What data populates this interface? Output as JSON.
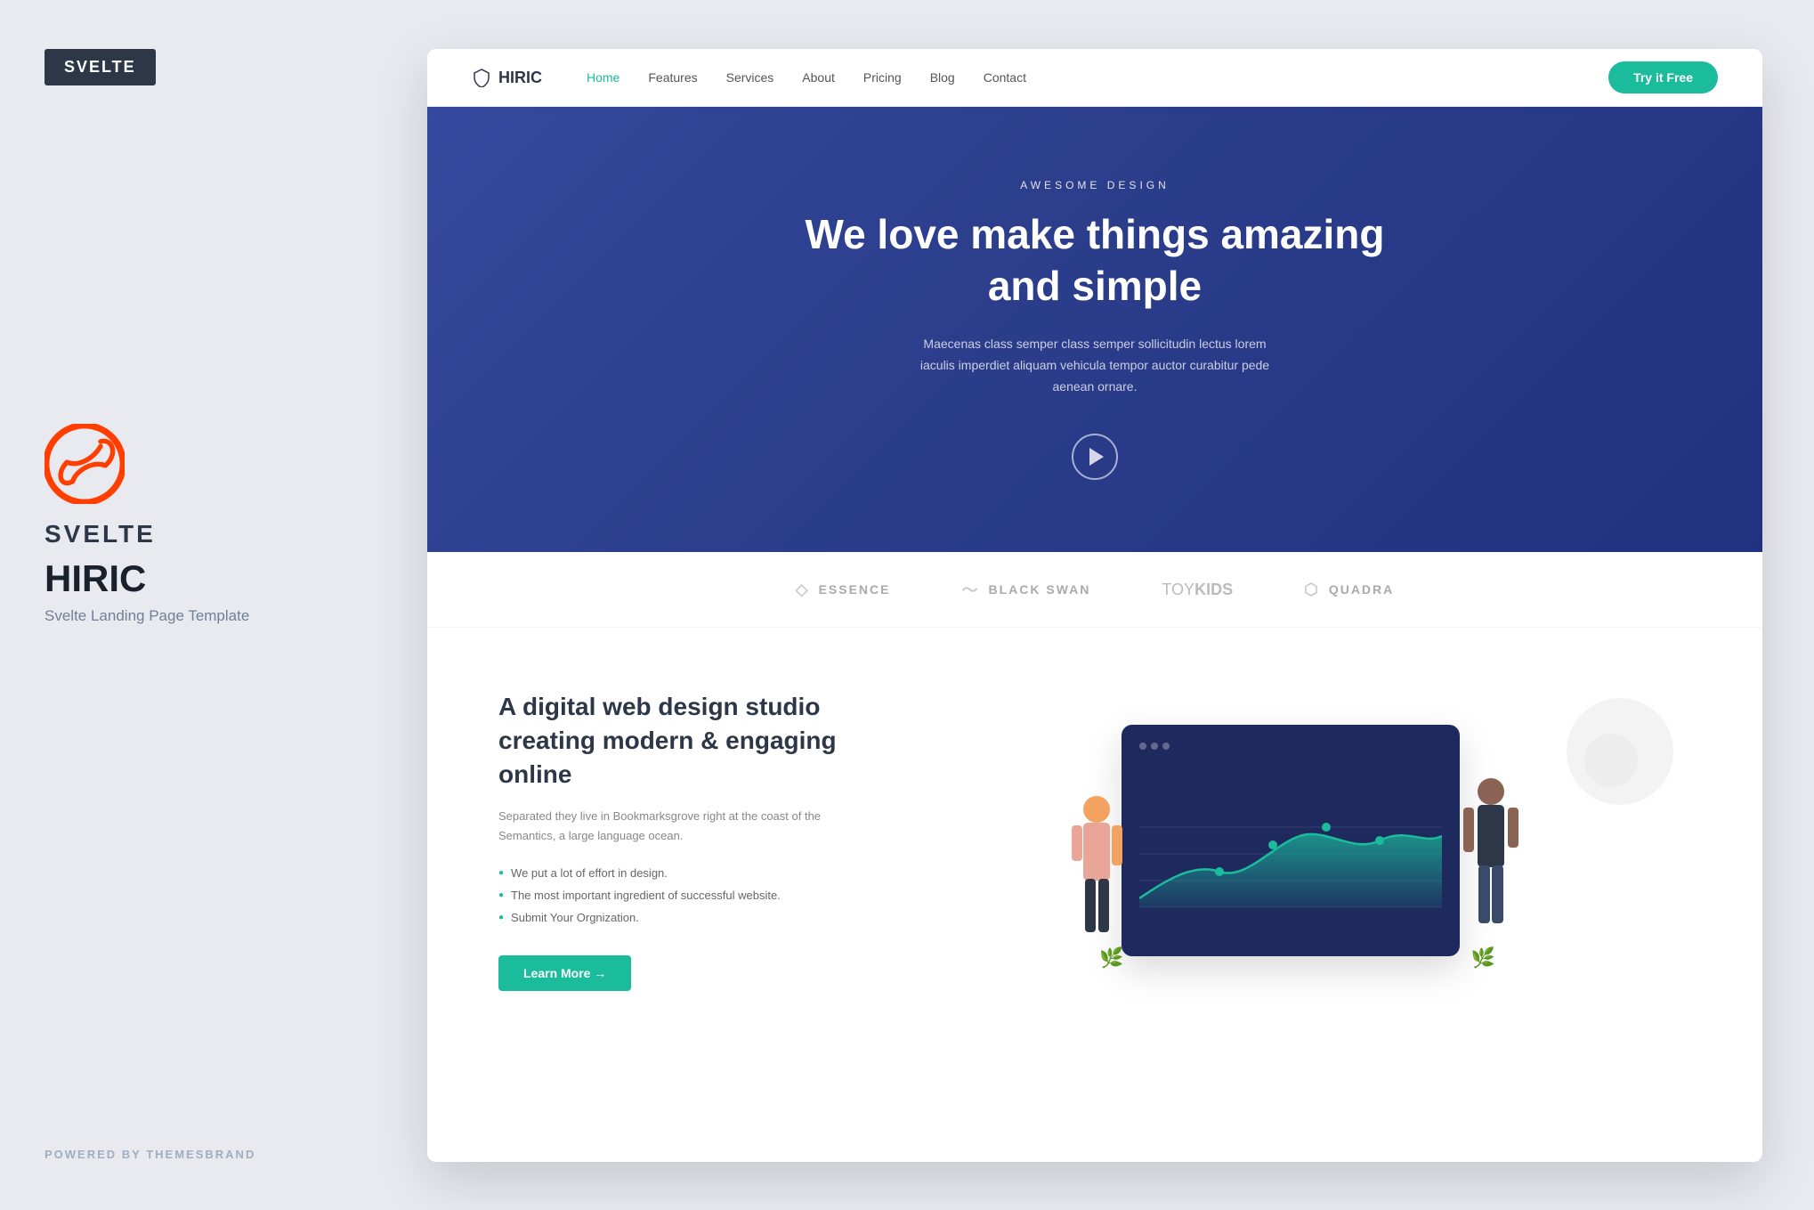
{
  "sidebar": {
    "badge": "SVELTE",
    "logo_name": "SVELTE",
    "product_name": "HIRIC",
    "description": "Svelte Landing Page Template",
    "powered_by": "POWERED BY THEMESBRAND"
  },
  "navbar": {
    "logo": "HIRIC",
    "links": [
      {
        "label": "Home",
        "active": true
      },
      {
        "label": "Features",
        "active": false
      },
      {
        "label": "Services",
        "active": false
      },
      {
        "label": "About",
        "active": false
      },
      {
        "label": "Pricing",
        "active": false
      },
      {
        "label": "Blog",
        "active": false
      },
      {
        "label": "Contact",
        "active": false
      }
    ],
    "cta": "Try it Free"
  },
  "hero": {
    "subtitle": "AWESOME DESIGN",
    "title": "We love make things amazing and simple",
    "description": "Maecenas class semper class semper sollicitudin lectus lorem iaculis imperdiet aliquam vehicula tempor auctor curabitur pede aenean ornare."
  },
  "clients": [
    {
      "name": "ESSENCE",
      "icon": "◇"
    },
    {
      "name": "BLACK SWAN",
      "icon": "~"
    },
    {
      "name": "toykids",
      "special": true
    },
    {
      "name": "QUADRA",
      "icon": "◇"
    }
  ],
  "features": {
    "title": "A digital web design studio creating modern & engaging online",
    "description": "Separated they live in Bookmarksgrove right at the coast of the Semantics, a large language ocean.",
    "list_items": [
      "We put a lot of effort in design.",
      "The most important ingredient of successful website.",
      "Submit Your Orgnization."
    ],
    "cta": "Learn More →"
  },
  "colors": {
    "accent": "#1abc9c",
    "dark": "#2d3748",
    "hero_bg": "#2c3e8c"
  }
}
